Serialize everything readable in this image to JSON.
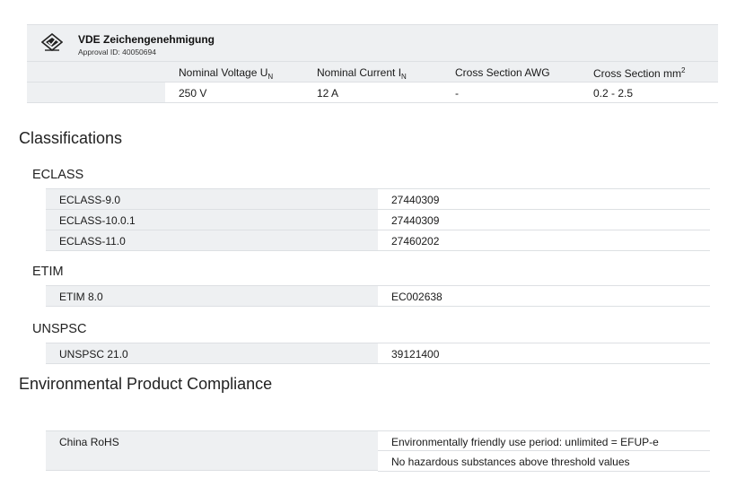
{
  "approval": {
    "title": "VDE Zeichengenehmigung",
    "approval_id": "Approval ID: 40050694",
    "columns": {
      "voltage": "Nominal Voltage U",
      "voltage_sub": "N",
      "current": "Nominal Current I",
      "current_sub": "N",
      "awg": "Cross Section AWG",
      "mm": "Cross Section mm",
      "mm_sup": "2"
    },
    "values": {
      "voltage": "250 V",
      "current": "12 A",
      "awg": "-",
      "mm": "0.2 - 2.5"
    }
  },
  "classifications": {
    "heading": "Classifications",
    "eclass": {
      "heading": "ECLASS",
      "rows": [
        {
          "key": "ECLASS-9.0",
          "value": "27440309"
        },
        {
          "key": "ECLASS-10.0.1",
          "value": "27440309"
        },
        {
          "key": "ECLASS-11.0",
          "value": "27460202"
        }
      ]
    },
    "etim": {
      "heading": "ETIM",
      "rows": [
        {
          "key": "ETIM 8.0",
          "value": "EC002638"
        }
      ]
    },
    "unspsc": {
      "heading": "UNSPSC",
      "rows": [
        {
          "key": "UNSPSC 21.0",
          "value": "39121400"
        }
      ]
    }
  },
  "compliance": {
    "heading": "Environmental Product Compliance",
    "china_rohs": {
      "key": "China RoHS",
      "values": [
        "Environmentally friendly use period: unlimited = EFUP-e",
        "No hazardous substances above threshold values"
      ]
    }
  }
}
